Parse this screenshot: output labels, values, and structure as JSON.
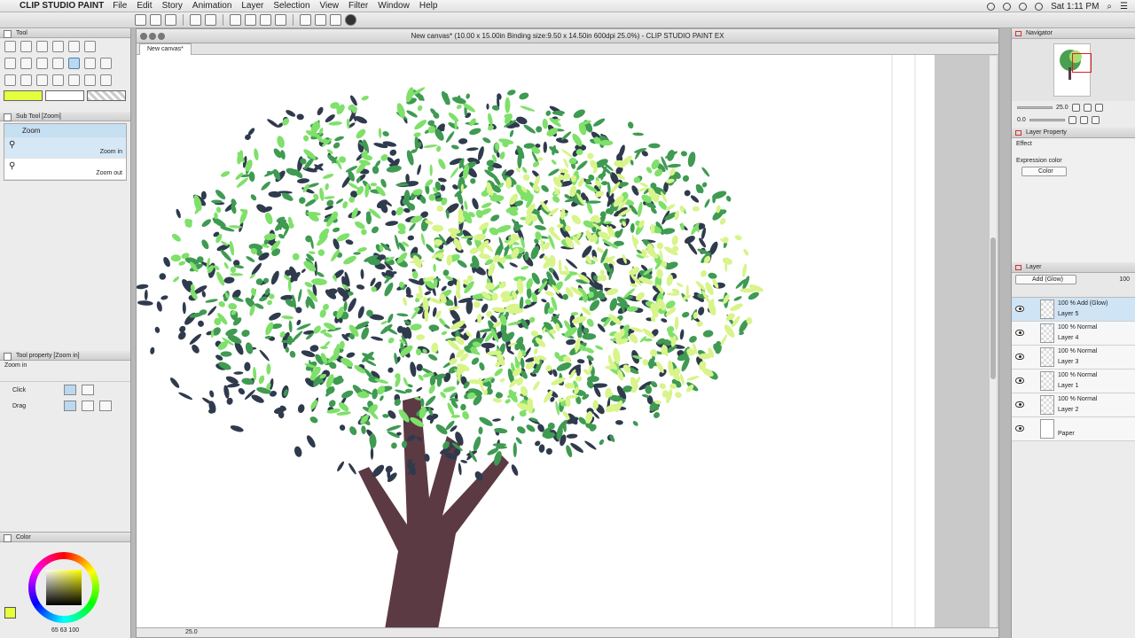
{
  "menubar": {
    "app_name": "CLIP STUDIO PAINT",
    "items": [
      "File",
      "Edit",
      "Story",
      "Animation",
      "Layer",
      "Selection",
      "View",
      "Filter",
      "Window",
      "Help"
    ],
    "clock": "Sat 1:11 PM"
  },
  "left": {
    "tool_tab": "Tool",
    "subtool_tab": "Sub Tool [Zoom]",
    "subtool_group": "Zoom",
    "subtools": [
      "Zoom in",
      "Zoom out"
    ],
    "toolprop_tab": "Tool property [Zoom in]",
    "toolprop_title": "Zoom in",
    "props": [
      "Click",
      "Drag"
    ],
    "color_tab": "Color",
    "color_readout": "65 63 100"
  },
  "canvas": {
    "title": "New canvas* (10.00 x 15.00in Binding size:9.50 x 14.50in 600dpi 25.0%) - CLIP STUDIO PAINT EX",
    "tab": "New canvas*",
    "zoom": "25.0"
  },
  "right": {
    "navigator_tab": "Navigator",
    "nav_zoom": "25.0",
    "nav_rotate": "0.0",
    "layer_property_tab": "Layer Property",
    "effect_label": "Effect",
    "expression_color_label": "Expression color",
    "expression_color_value": "Color",
    "layer_tab": "Layer",
    "blend_mode": "Add (Glow)",
    "opacity": "100",
    "layers": [
      {
        "mode": "100 % Add (Glow)",
        "name": "Layer 5"
      },
      {
        "mode": "100 % Normal",
        "name": "Layer 4"
      },
      {
        "mode": "100 % Normal",
        "name": "Layer 3"
      },
      {
        "mode": "100 % Normal",
        "name": "Layer 1"
      },
      {
        "mode": "100 % Normal",
        "name": "Layer 2"
      },
      {
        "mode": "",
        "name": "Paper"
      }
    ]
  },
  "colors": {
    "main_color": "#e6ff3c",
    "trunk": "#5c3a44",
    "leaf_dark": "#2f3a4d",
    "leaf_mid": "#3f9a52",
    "leaf_light": "#7fe06a",
    "leaf_glow": "#d8f48a"
  },
  "icons": [
    "apple-icon",
    "wifi-icon",
    "search-icon",
    "menu-icon",
    "eye-icon",
    "magnifier-icon",
    "help-icon"
  ]
}
